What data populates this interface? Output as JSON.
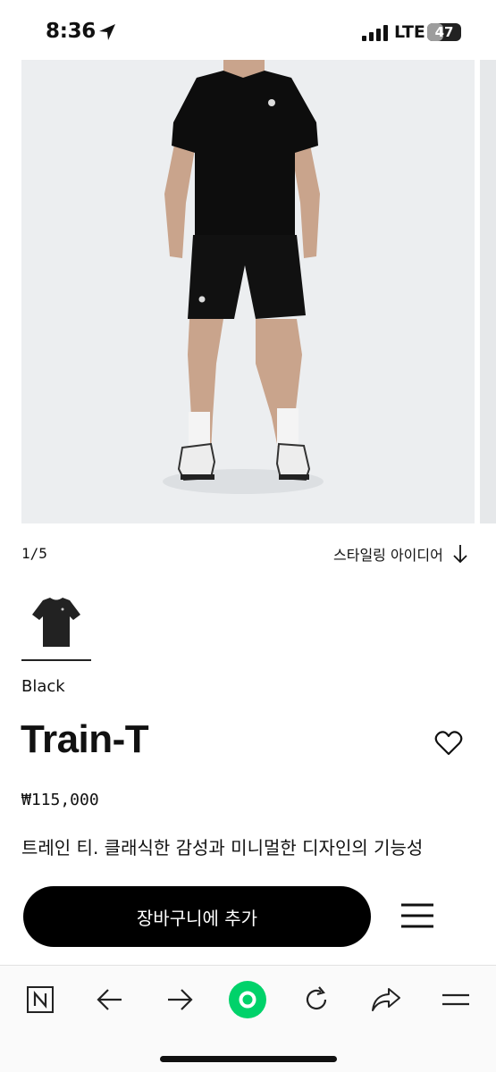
{
  "status_bar": {
    "time": "8:36",
    "network": "LTE",
    "battery": "47",
    "battery_level": 0.47
  },
  "gallery": {
    "counter": "1/5",
    "styling_link": "스타일링 아이디어"
  },
  "product": {
    "color_name": "Black",
    "title": "Train-T",
    "price": "₩115,000",
    "description": "트레인 티. 클래식한 감성과 미니멀한 디자인의 기능성"
  },
  "cart": {
    "add_to_cart_label": "장바구니에 추가"
  },
  "browser_toolbar": {
    "icons": [
      "naver-n-icon",
      "back-arrow-icon",
      "forward-arrow-icon",
      "green-dot-icon",
      "refresh-icon",
      "share-icon",
      "menu-lines-icon"
    ]
  },
  "colors": {
    "accent_green": "#00d26a",
    "button_black": "#000000",
    "image_bg": "#eceef0"
  }
}
